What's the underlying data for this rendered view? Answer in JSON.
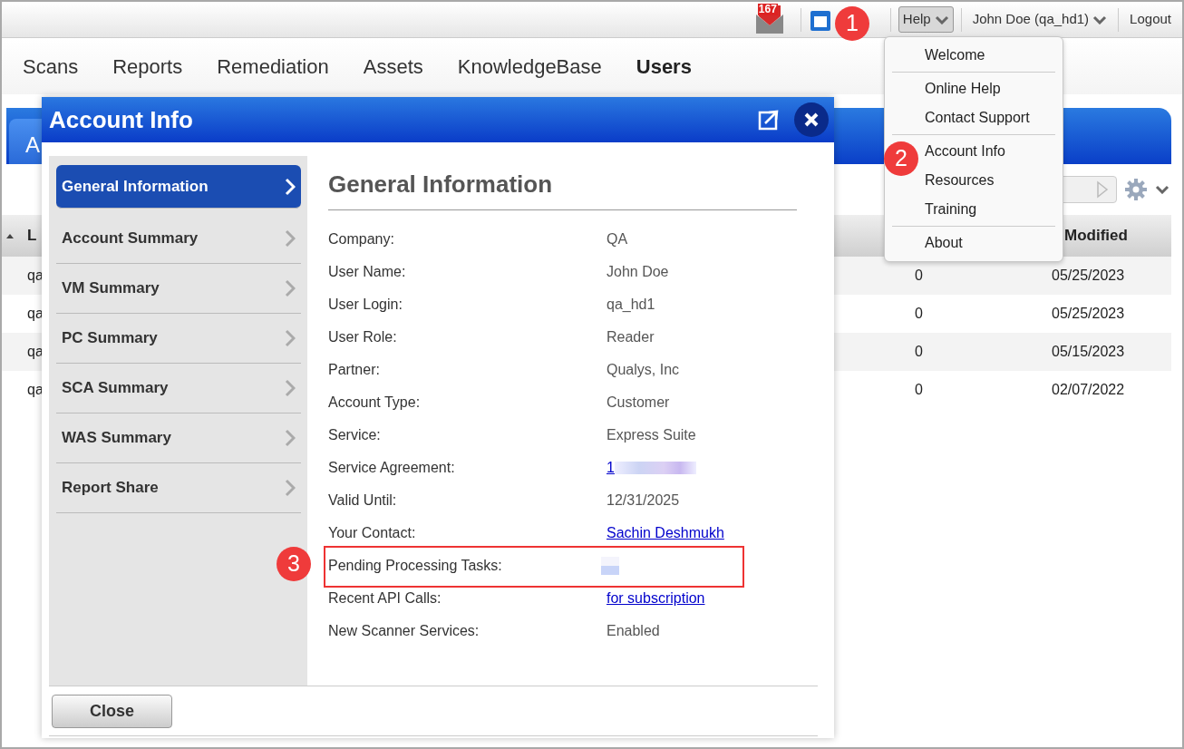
{
  "top_bar": {
    "notification_count": "167",
    "help_label": "Help",
    "help_open": true,
    "user_label": "John Doe (qa_hd1)",
    "logout_label": "Logout"
  },
  "nav": [
    {
      "label": "Scans",
      "selected": false
    },
    {
      "label": "Reports",
      "selected": false
    },
    {
      "label": "Remediation",
      "selected": false
    },
    {
      "label": "Assets",
      "selected": false
    },
    {
      "label": "KnowledgeBase",
      "selected": false
    },
    {
      "label": "Users",
      "selected": true
    }
  ],
  "background_tab": {
    "label": "A"
  },
  "table": {
    "columns": [
      "L",
      "Modified"
    ],
    "rows": [
      {
        "column_1": "qa",
        "column_2": "0",
        "column_3": "05/25/2023"
      },
      {
        "column_1": "qa",
        "column_2": "0",
        "column_3": "05/25/2023"
      },
      {
        "column_1": "qa",
        "column_2": "0",
        "column_3": "05/15/2023"
      },
      {
        "column_1": "qa",
        "column_2": "0",
        "column_3": "02/07/2022"
      }
    ]
  },
  "help_menu": {
    "groups": [
      [
        "Welcome"
      ],
      [
        "Online Help",
        "Contact Support"
      ],
      [
        "Account Info",
        "Resources",
        "Training"
      ],
      [
        "About"
      ]
    ]
  },
  "dialog": {
    "title": "Account Info",
    "sidebar": [
      {
        "label": "General Information",
        "selected": true
      },
      {
        "label": "Account Summary",
        "selected": false
      },
      {
        "label": "VM Summary",
        "selected": false
      },
      {
        "label": "PC Summary",
        "selected": false
      },
      {
        "label": "SCA Summary",
        "selected": false
      },
      {
        "label": "WAS Summary",
        "selected": false
      },
      {
        "label": "Report Share",
        "selected": false
      }
    ],
    "heading": "General Information",
    "fields": [
      {
        "label": "Company:",
        "value": "QA",
        "kind": "text",
        "highlighted": false
      },
      {
        "label": "User Name:",
        "value": "John Doe",
        "kind": "text",
        "highlighted": false
      },
      {
        "label": "User Login:",
        "value": "qa_hd1",
        "kind": "text",
        "highlighted": false
      },
      {
        "label": "User Role:",
        "value": "Reader",
        "kind": "text",
        "highlighted": false
      },
      {
        "label": "Partner:",
        "value": "Qualys, Inc",
        "kind": "text",
        "highlighted": false
      },
      {
        "label": "Account Type:",
        "value": "Customer",
        "kind": "text",
        "highlighted": false
      },
      {
        "label": "Service:",
        "value": "Express Suite",
        "kind": "text",
        "highlighted": false
      },
      {
        "label": "Service Agreement:",
        "value": "1",
        "kind": "redacted-link",
        "highlighted": false
      },
      {
        "label": "Valid Until:",
        "value": "12/31/2025",
        "kind": "text",
        "highlighted": false
      },
      {
        "label": "Your Contact:",
        "value": "Sachin Deshmukh",
        "kind": "link",
        "highlighted": false
      },
      {
        "label": "Pending Processing Tasks:",
        "kind": "redacted",
        "highlighted": true
      },
      {
        "label": "Recent API Calls:",
        "value": "for subscription",
        "kind": "link",
        "highlighted": false
      },
      {
        "label": "New Scanner Services:",
        "value": "Enabled",
        "kind": "text",
        "highlighted": false
      }
    ],
    "close_button": "Close"
  },
  "callouts": [
    {
      "number": "1"
    },
    {
      "number": "2"
    },
    {
      "number": "3"
    }
  ]
}
